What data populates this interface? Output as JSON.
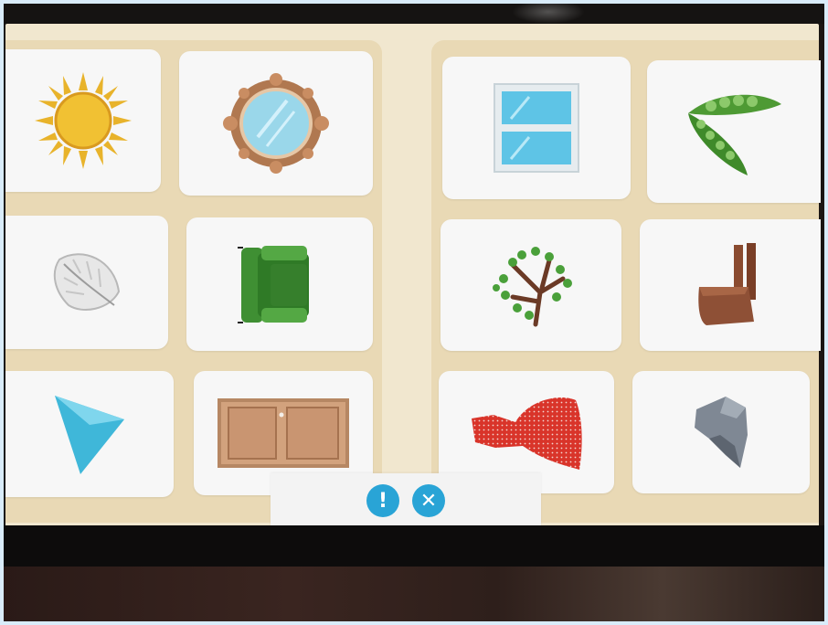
{
  "colors": {
    "screen_background": "#f1e7cf",
    "panel_background": "#e9d9b5",
    "card_background": "#f7f7f7",
    "button_accent": "#29a4d6"
  },
  "cards": [
    {
      "icon": "sun-icon"
    },
    {
      "icon": "mirror-icon"
    },
    {
      "icon": "window-icon"
    },
    {
      "icon": "peas-icon"
    },
    {
      "icon": "feather-icon"
    },
    {
      "icon": "sofa-icon"
    },
    {
      "icon": "tree-icon"
    },
    {
      "icon": "chair-icon"
    },
    {
      "icon": "triangle-icon"
    },
    {
      "icon": "door-icon"
    },
    {
      "icon": "dress-icon"
    },
    {
      "icon": "rock-icon"
    }
  ],
  "controls": {
    "info_glyph": "!",
    "close_glyph": "✕"
  }
}
